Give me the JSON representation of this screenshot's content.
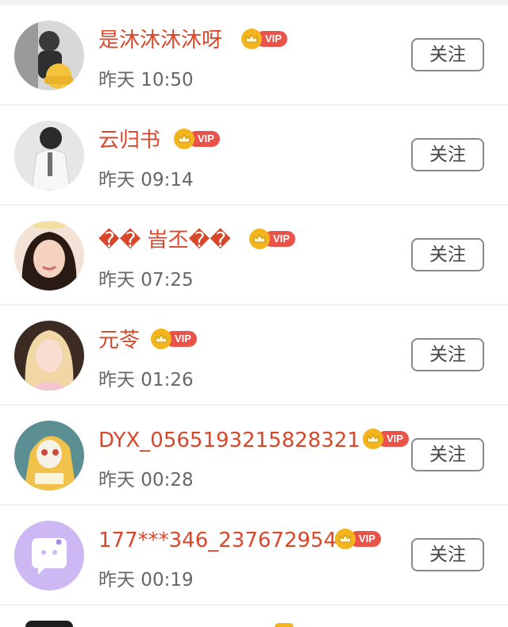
{
  "users": [
    {
      "name": "是沐沐沐沐呀",
      "time": "昨天 10:50",
      "follow_label": "关注",
      "vip_label": "VIP",
      "avatar": "boy-with-yellow-hat-photo"
    },
    {
      "name": "云归书",
      "time": "昨天 09:14",
      "follow_label": "关注",
      "vip_label": "VIP",
      "avatar": "girl-white-shirt-photo"
    },
    {
      "name": "�� 峕丕��",
      "time": "昨天 07:25",
      "follow_label": "关注",
      "vip_label": "VIP",
      "avatar": "girl-smiling-portrait-photo"
    },
    {
      "name": "元苓",
      "time": "昨天 01:26",
      "follow_label": "关注",
      "vip_label": "VIP",
      "avatar": "blonde-girl-photo"
    },
    {
      "name": "DYX_0565193215828321",
      "time": "昨天 00:28",
      "follow_label": "关注",
      "vip_label": "VIP",
      "avatar": "cartoon-character-avatar"
    },
    {
      "name": "177***346_237672954",
      "time": "昨天 00:19",
      "follow_label": "关注",
      "vip_label": "VIP",
      "avatar": "default-chat-bubble-avatar"
    }
  ],
  "colors": {
    "name": "#d9472b",
    "vip_tag": "#e9534a",
    "crown": "#f3b51b",
    "time": "#666666",
    "divider": "#f2f2f2"
  }
}
